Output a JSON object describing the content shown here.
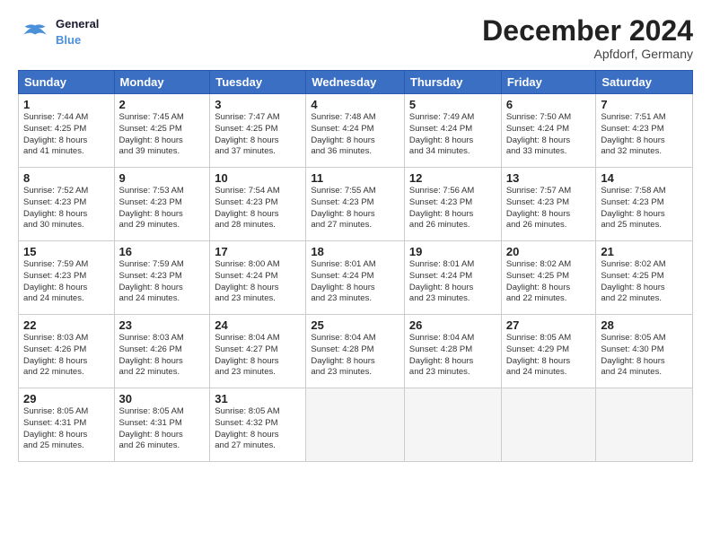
{
  "header": {
    "title": "December 2024",
    "location": "Apfdorf, Germany",
    "logo_line1": "General",
    "logo_line2": "Blue"
  },
  "days_of_week": [
    "Sunday",
    "Monday",
    "Tuesday",
    "Wednesday",
    "Thursday",
    "Friday",
    "Saturday"
  ],
  "weeks": [
    [
      {
        "day": 1,
        "sunrise": "7:44 AM",
        "sunset": "4:25 PM",
        "daylight": "8 hours and 41 minutes."
      },
      {
        "day": 2,
        "sunrise": "7:45 AM",
        "sunset": "4:25 PM",
        "daylight": "8 hours and 39 minutes."
      },
      {
        "day": 3,
        "sunrise": "7:47 AM",
        "sunset": "4:25 PM",
        "daylight": "8 hours and 37 minutes."
      },
      {
        "day": 4,
        "sunrise": "7:48 AM",
        "sunset": "4:24 PM",
        "daylight": "8 hours and 36 minutes."
      },
      {
        "day": 5,
        "sunrise": "7:49 AM",
        "sunset": "4:24 PM",
        "daylight": "8 hours and 34 minutes."
      },
      {
        "day": 6,
        "sunrise": "7:50 AM",
        "sunset": "4:24 PM",
        "daylight": "8 hours and 33 minutes."
      },
      {
        "day": 7,
        "sunrise": "7:51 AM",
        "sunset": "4:23 PM",
        "daylight": "8 hours and 32 minutes."
      }
    ],
    [
      {
        "day": 8,
        "sunrise": "7:52 AM",
        "sunset": "4:23 PM",
        "daylight": "8 hours and 30 minutes."
      },
      {
        "day": 9,
        "sunrise": "7:53 AM",
        "sunset": "4:23 PM",
        "daylight": "8 hours and 29 minutes."
      },
      {
        "day": 10,
        "sunrise": "7:54 AM",
        "sunset": "4:23 PM",
        "daylight": "8 hours and 28 minutes."
      },
      {
        "day": 11,
        "sunrise": "7:55 AM",
        "sunset": "4:23 PM",
        "daylight": "8 hours and 27 minutes."
      },
      {
        "day": 12,
        "sunrise": "7:56 AM",
        "sunset": "4:23 PM",
        "daylight": "8 hours and 26 minutes."
      },
      {
        "day": 13,
        "sunrise": "7:57 AM",
        "sunset": "4:23 PM",
        "daylight": "8 hours and 26 minutes."
      },
      {
        "day": 14,
        "sunrise": "7:58 AM",
        "sunset": "4:23 PM",
        "daylight": "8 hours and 25 minutes."
      }
    ],
    [
      {
        "day": 15,
        "sunrise": "7:59 AM",
        "sunset": "4:23 PM",
        "daylight": "8 hours and 24 minutes."
      },
      {
        "day": 16,
        "sunrise": "7:59 AM",
        "sunset": "4:23 PM",
        "daylight": "8 hours and 24 minutes."
      },
      {
        "day": 17,
        "sunrise": "8:00 AM",
        "sunset": "4:24 PM",
        "daylight": "8 hours and 23 minutes."
      },
      {
        "day": 18,
        "sunrise": "8:01 AM",
        "sunset": "4:24 PM",
        "daylight": "8 hours and 23 minutes."
      },
      {
        "day": 19,
        "sunrise": "8:01 AM",
        "sunset": "4:24 PM",
        "daylight": "8 hours and 23 minutes."
      },
      {
        "day": 20,
        "sunrise": "8:02 AM",
        "sunset": "4:25 PM",
        "daylight": "8 hours and 22 minutes."
      },
      {
        "day": 21,
        "sunrise": "8:02 AM",
        "sunset": "4:25 PM",
        "daylight": "8 hours and 22 minutes."
      }
    ],
    [
      {
        "day": 22,
        "sunrise": "8:03 AM",
        "sunset": "4:26 PM",
        "daylight": "8 hours and 22 minutes."
      },
      {
        "day": 23,
        "sunrise": "8:03 AM",
        "sunset": "4:26 PM",
        "daylight": "8 hours and 22 minutes."
      },
      {
        "day": 24,
        "sunrise": "8:04 AM",
        "sunset": "4:27 PM",
        "daylight": "8 hours and 23 minutes."
      },
      {
        "day": 25,
        "sunrise": "8:04 AM",
        "sunset": "4:28 PM",
        "daylight": "8 hours and 23 minutes."
      },
      {
        "day": 26,
        "sunrise": "8:04 AM",
        "sunset": "4:28 PM",
        "daylight": "8 hours and 23 minutes."
      },
      {
        "day": 27,
        "sunrise": "8:05 AM",
        "sunset": "4:29 PM",
        "daylight": "8 hours and 24 minutes."
      },
      {
        "day": 28,
        "sunrise": "8:05 AM",
        "sunset": "4:30 PM",
        "daylight": "8 hours and 24 minutes."
      }
    ],
    [
      {
        "day": 29,
        "sunrise": "8:05 AM",
        "sunset": "4:31 PM",
        "daylight": "8 hours and 25 minutes."
      },
      {
        "day": 30,
        "sunrise": "8:05 AM",
        "sunset": "4:31 PM",
        "daylight": "8 hours and 26 minutes."
      },
      {
        "day": 31,
        "sunrise": "8:05 AM",
        "sunset": "4:32 PM",
        "daylight": "8 hours and 27 minutes."
      },
      null,
      null,
      null,
      null
    ]
  ]
}
